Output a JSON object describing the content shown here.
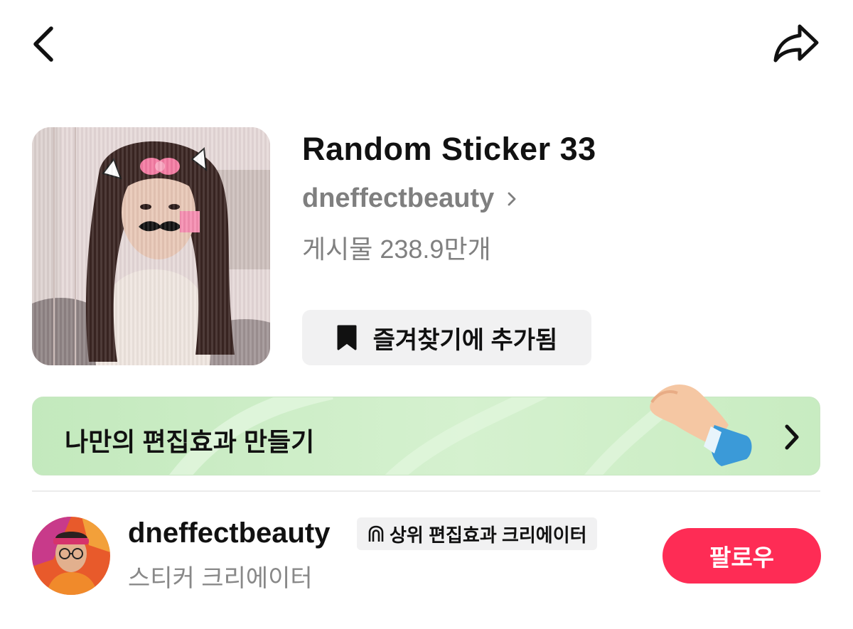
{
  "header": {
    "back_icon": "chevron-left-icon",
    "share_icon": "share-arrow-icon"
  },
  "effect": {
    "title": "Random Sticker 33",
    "creator": "dneffectbeauty",
    "posts": "게시물 238.9만개",
    "favorite_label": "즐겨찾기에 추가됨",
    "favorite_icon": "bookmark-icon"
  },
  "banner": {
    "label": "나만의 편집효과 만들기",
    "illustration": "hand-with-pencil-icon",
    "arrow_icon": "chevron-right-icon"
  },
  "creator_card": {
    "username": "dneffectbeauty",
    "badge_label": "상위 편집효과 크리에이터",
    "badge_icon": "award-icon",
    "role": "스티커 크리에이터",
    "follow_label": "팔로우"
  },
  "colors": {
    "accent": "#fe2c55",
    "banner_bg": "#cfeec9",
    "muted_text": "#808080"
  }
}
